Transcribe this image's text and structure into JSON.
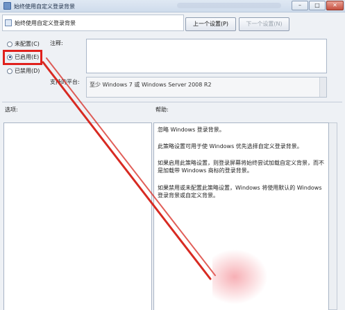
{
  "window": {
    "title": "始终使用自定义登录背景"
  },
  "policy": {
    "title": "始终使用自定义登录背景"
  },
  "toolbar": {
    "prev_label": "上一个设置(P)",
    "next_label": "下一个设置(N)"
  },
  "state": {
    "options": [
      {
        "label": "未配置(C)",
        "checked": false
      },
      {
        "label": "已启用(E)",
        "checked": true
      },
      {
        "label": "已禁用(D)",
        "checked": false
      }
    ]
  },
  "fields": {
    "note_label": "注释:",
    "note_value": "",
    "platform_label": "支持的平台:",
    "platform_value": "至少 Windows 7 或 Windows Server 2008 R2"
  },
  "panes": {
    "options_label": "选项:",
    "help_label": "帮助:",
    "help_paragraphs": [
      "忽略 Windows 登录背景。",
      "此策略设置可用于使 Windows 优先选择自定义登录背景。",
      "如果启用此策略设置，则登录屏幕将始终尝试加载自定义背景，而不是加载带 Windows 商标的登录背景。",
      "如果禁用或未配置此策略设置，Windows 将使用默认的 Windows 登录背景或自定义背景。"
    ]
  },
  "annotation": {
    "highlight_color": "#e0201c"
  }
}
